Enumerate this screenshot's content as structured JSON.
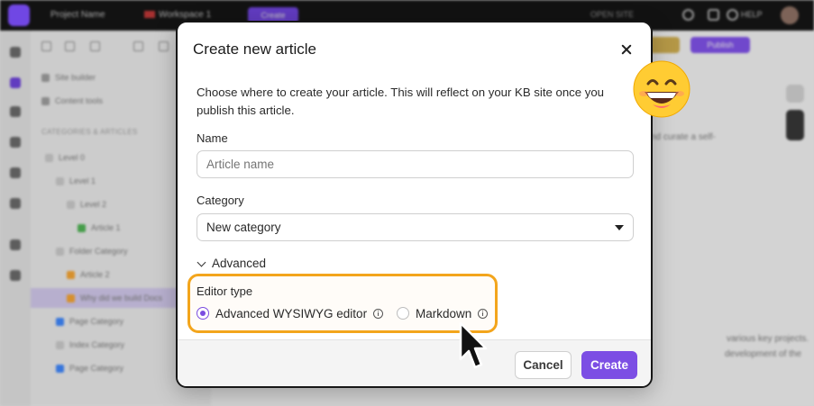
{
  "background": {
    "topbar": {
      "project_label": "Project Name",
      "workspace_label": "Workspace 1",
      "create_label": "Create",
      "open_site_label": "OPEN SITE",
      "help_label": "HELP"
    },
    "sidebar": {
      "site_builder": "Site builder",
      "content_tools": "Content tools",
      "section_title": "CATEGORIES & ARTICLES",
      "tree": [
        {
          "label": "Level 0"
        },
        {
          "label": "Level 1"
        },
        {
          "label": "Level 2"
        },
        {
          "label": "Article 1"
        },
        {
          "label": "Folder Category"
        },
        {
          "label": "Article 2"
        },
        {
          "label": "Why did we build Docs"
        },
        {
          "label": "Page Category"
        },
        {
          "label": "Index Category"
        },
        {
          "label": "Page Category"
        }
      ]
    },
    "main": {
      "publish_label": "Publish",
      "text_1": "nd curate a self-",
      "text_2": "various key projects.",
      "text_3": "development of the"
    }
  },
  "modal": {
    "title": "Create new article",
    "description": "Choose where to create your article. This will reflect on your KB site once you publish this article.",
    "name": {
      "label": "Name",
      "placeholder": "Article name"
    },
    "category": {
      "label": "Category",
      "selected": "New category"
    },
    "advanced_label": "Advanced",
    "editor_type": {
      "label": "Editor type",
      "options": [
        {
          "label": "Advanced WYSIWYG editor",
          "checked": true
        },
        {
          "label": "Markdown",
          "checked": false
        }
      ]
    },
    "buttons": {
      "cancel": "Cancel",
      "create": "Create"
    }
  },
  "colors": {
    "accent": "#7c4ee4",
    "highlight": "#f3a51c",
    "topbar": "#111111"
  },
  "icons": {
    "close": "close-icon",
    "dropdown": "chevron-down-icon",
    "info": "info-icon",
    "decoration_emoji": "grinning-emoji",
    "pointer": "mouse-pointer-icon"
  }
}
